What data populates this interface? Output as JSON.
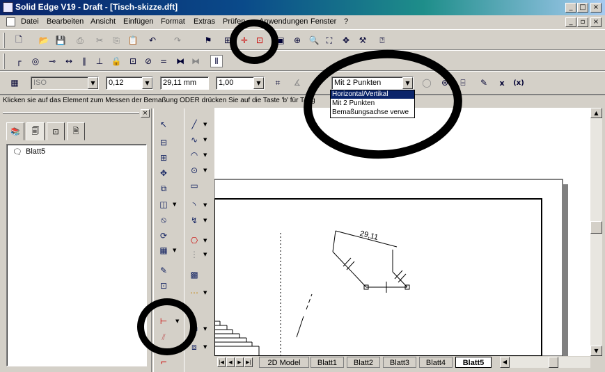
{
  "window": {
    "title": "Solid Edge V19 - Draft - [Tisch-skizze.dft]",
    "controls": [
      "_",
      "□",
      "×"
    ]
  },
  "menu": [
    "Datei",
    "Bearbeiten",
    "Ansicht",
    "Einfügen",
    "Format",
    "Extras",
    "Prüfen",
    "Anwendungen",
    "Fenster",
    "?"
  ],
  "ribbon": {
    "standard_value": "ISO",
    "line_width": "0,12",
    "measured_value": "29,11 mm",
    "scale": "1,00",
    "measure_mode": "Mit 2 Punkten",
    "close_label": "x",
    "cancel_label": "(x)"
  },
  "measure_mode_options": [
    "Horizontal/Vertikal",
    "Mit 2 Punkten",
    "Bemaßungsachse verwe"
  ],
  "status": {
    "prompt": "Klicken sie auf das Element zum Messen der Bemaßung ODER drücken Sie auf die Taste 'b' für Tang"
  },
  "tree": {
    "items": [
      "Blatt5"
    ]
  },
  "drawing": {
    "dimension_value": "29,11"
  },
  "sheets": {
    "tabs": [
      "2D Model",
      "Blatt1",
      "Blatt2",
      "Blatt3",
      "Blatt4",
      "Blatt5"
    ],
    "active": "Blatt5"
  },
  "colors": {
    "title_gradient_start": "#0a246a",
    "title_gradient_end": "#a6caf0",
    "selection": "#0a246a",
    "annotation_marker": "#000000"
  }
}
